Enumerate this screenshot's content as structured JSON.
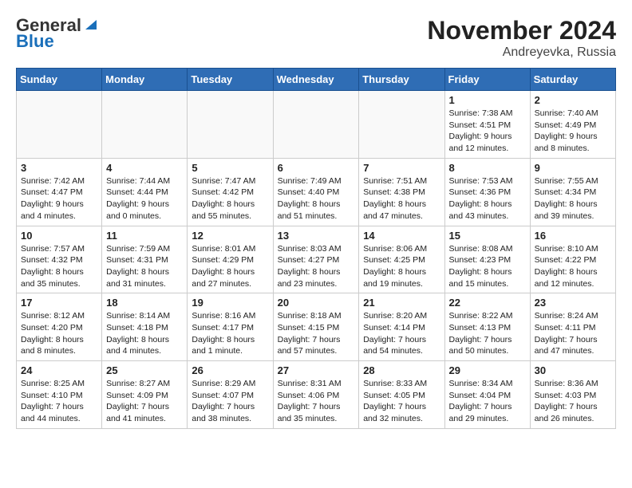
{
  "logo": {
    "general": "General",
    "blue": "Blue"
  },
  "title": "November 2024",
  "subtitle": "Andreyevka, Russia",
  "days_of_week": [
    "Sunday",
    "Monday",
    "Tuesday",
    "Wednesday",
    "Thursday",
    "Friday",
    "Saturday"
  ],
  "weeks": [
    [
      {
        "day": "",
        "sunrise": "",
        "sunset": "",
        "daylight": ""
      },
      {
        "day": "",
        "sunrise": "",
        "sunset": "",
        "daylight": ""
      },
      {
        "day": "",
        "sunrise": "",
        "sunset": "",
        "daylight": ""
      },
      {
        "day": "",
        "sunrise": "",
        "sunset": "",
        "daylight": ""
      },
      {
        "day": "",
        "sunrise": "",
        "sunset": "",
        "daylight": ""
      },
      {
        "day": "1",
        "sunrise": "Sunrise: 7:38 AM",
        "sunset": "Sunset: 4:51 PM",
        "daylight": "Daylight: 9 hours and 12 minutes."
      },
      {
        "day": "2",
        "sunrise": "Sunrise: 7:40 AM",
        "sunset": "Sunset: 4:49 PM",
        "daylight": "Daylight: 9 hours and 8 minutes."
      }
    ],
    [
      {
        "day": "3",
        "sunrise": "Sunrise: 7:42 AM",
        "sunset": "Sunset: 4:47 PM",
        "daylight": "Daylight: 9 hours and 4 minutes."
      },
      {
        "day": "4",
        "sunrise": "Sunrise: 7:44 AM",
        "sunset": "Sunset: 4:44 PM",
        "daylight": "Daylight: 9 hours and 0 minutes."
      },
      {
        "day": "5",
        "sunrise": "Sunrise: 7:47 AM",
        "sunset": "Sunset: 4:42 PM",
        "daylight": "Daylight: 8 hours and 55 minutes."
      },
      {
        "day": "6",
        "sunrise": "Sunrise: 7:49 AM",
        "sunset": "Sunset: 4:40 PM",
        "daylight": "Daylight: 8 hours and 51 minutes."
      },
      {
        "day": "7",
        "sunrise": "Sunrise: 7:51 AM",
        "sunset": "Sunset: 4:38 PM",
        "daylight": "Daylight: 8 hours and 47 minutes."
      },
      {
        "day": "8",
        "sunrise": "Sunrise: 7:53 AM",
        "sunset": "Sunset: 4:36 PM",
        "daylight": "Daylight: 8 hours and 43 minutes."
      },
      {
        "day": "9",
        "sunrise": "Sunrise: 7:55 AM",
        "sunset": "Sunset: 4:34 PM",
        "daylight": "Daylight: 8 hours and 39 minutes."
      }
    ],
    [
      {
        "day": "10",
        "sunrise": "Sunrise: 7:57 AM",
        "sunset": "Sunset: 4:32 PM",
        "daylight": "Daylight: 8 hours and 35 minutes."
      },
      {
        "day": "11",
        "sunrise": "Sunrise: 7:59 AM",
        "sunset": "Sunset: 4:31 PM",
        "daylight": "Daylight: 8 hours and 31 minutes."
      },
      {
        "day": "12",
        "sunrise": "Sunrise: 8:01 AM",
        "sunset": "Sunset: 4:29 PM",
        "daylight": "Daylight: 8 hours and 27 minutes."
      },
      {
        "day": "13",
        "sunrise": "Sunrise: 8:03 AM",
        "sunset": "Sunset: 4:27 PM",
        "daylight": "Daylight: 8 hours and 23 minutes."
      },
      {
        "day": "14",
        "sunrise": "Sunrise: 8:06 AM",
        "sunset": "Sunset: 4:25 PM",
        "daylight": "Daylight: 8 hours and 19 minutes."
      },
      {
        "day": "15",
        "sunrise": "Sunrise: 8:08 AM",
        "sunset": "Sunset: 4:23 PM",
        "daylight": "Daylight: 8 hours and 15 minutes."
      },
      {
        "day": "16",
        "sunrise": "Sunrise: 8:10 AM",
        "sunset": "Sunset: 4:22 PM",
        "daylight": "Daylight: 8 hours and 12 minutes."
      }
    ],
    [
      {
        "day": "17",
        "sunrise": "Sunrise: 8:12 AM",
        "sunset": "Sunset: 4:20 PM",
        "daylight": "Daylight: 8 hours and 8 minutes."
      },
      {
        "day": "18",
        "sunrise": "Sunrise: 8:14 AM",
        "sunset": "Sunset: 4:18 PM",
        "daylight": "Daylight: 8 hours and 4 minutes."
      },
      {
        "day": "19",
        "sunrise": "Sunrise: 8:16 AM",
        "sunset": "Sunset: 4:17 PM",
        "daylight": "Daylight: 8 hours and 1 minute."
      },
      {
        "day": "20",
        "sunrise": "Sunrise: 8:18 AM",
        "sunset": "Sunset: 4:15 PM",
        "daylight": "Daylight: 7 hours and 57 minutes."
      },
      {
        "day": "21",
        "sunrise": "Sunrise: 8:20 AM",
        "sunset": "Sunset: 4:14 PM",
        "daylight": "Daylight: 7 hours and 54 minutes."
      },
      {
        "day": "22",
        "sunrise": "Sunrise: 8:22 AM",
        "sunset": "Sunset: 4:13 PM",
        "daylight": "Daylight: 7 hours and 50 minutes."
      },
      {
        "day": "23",
        "sunrise": "Sunrise: 8:24 AM",
        "sunset": "Sunset: 4:11 PM",
        "daylight": "Daylight: 7 hours and 47 minutes."
      }
    ],
    [
      {
        "day": "24",
        "sunrise": "Sunrise: 8:25 AM",
        "sunset": "Sunset: 4:10 PM",
        "daylight": "Daylight: 7 hours and 44 minutes."
      },
      {
        "day": "25",
        "sunrise": "Sunrise: 8:27 AM",
        "sunset": "Sunset: 4:09 PM",
        "daylight": "Daylight: 7 hours and 41 minutes."
      },
      {
        "day": "26",
        "sunrise": "Sunrise: 8:29 AM",
        "sunset": "Sunset: 4:07 PM",
        "daylight": "Daylight: 7 hours and 38 minutes."
      },
      {
        "day": "27",
        "sunrise": "Sunrise: 8:31 AM",
        "sunset": "Sunset: 4:06 PM",
        "daylight": "Daylight: 7 hours and 35 minutes."
      },
      {
        "day": "28",
        "sunrise": "Sunrise: 8:33 AM",
        "sunset": "Sunset: 4:05 PM",
        "daylight": "Daylight: 7 hours and 32 minutes."
      },
      {
        "day": "29",
        "sunrise": "Sunrise: 8:34 AM",
        "sunset": "Sunset: 4:04 PM",
        "daylight": "Daylight: 7 hours and 29 minutes."
      },
      {
        "day": "30",
        "sunrise": "Sunrise: 8:36 AM",
        "sunset": "Sunset: 4:03 PM",
        "daylight": "Daylight: 7 hours and 26 minutes."
      }
    ]
  ]
}
